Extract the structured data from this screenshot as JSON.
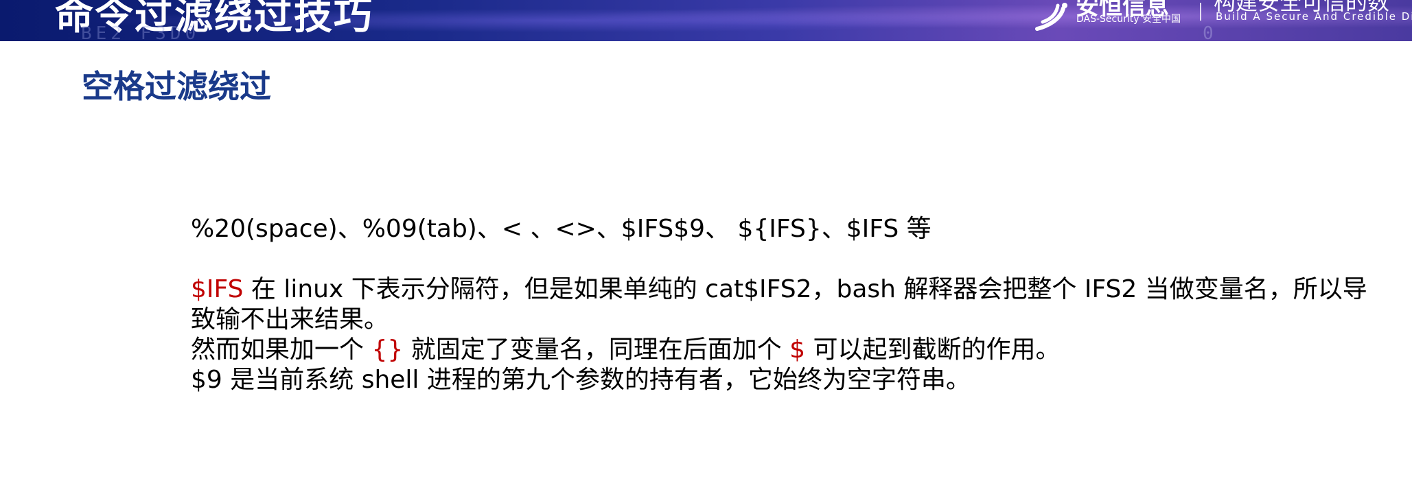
{
  "banner": {
    "title": "命令过滤绕过技巧",
    "hex_text": "BE2 F3D0",
    "zero_text": "0",
    "brand_cn": "安恒信息",
    "brand_en": "DAS-Security 安全中国",
    "slogan_cn": "构建安全可信的数",
    "slogan_en": "Build A Secure And Credible Dig"
  },
  "section_title": "空格过滤绕过",
  "content": {
    "line1": "%20(space)、%09(tab)、< 、<>、$IFS$9、 ${IFS}、$IFS 等",
    "line2_red": "$IFS",
    "line2_rest": " 在 linux 下表示分隔符，但是如果单纯的 cat$IFS2，bash 解释器会把整个 IFS2 当做变量名，所以导致输不出来结果。",
    "line3_a": "然而如果加一个 ",
    "line3_red1": "{}",
    "line3_b": " 就固定了变量名，同理在后面加个 ",
    "line3_red2": "$",
    "line3_c": " 可以起到截断的作用。",
    "line4": "$9 是当前系统 shell 进程的第九个参数的持有者，它始终为空字符串。"
  },
  "colors": {
    "title_blue": "#1a3a8a",
    "highlight_red": "#c00000",
    "banner_dark": "#0a1a6e",
    "banner_purple": "#6a4ab8"
  }
}
